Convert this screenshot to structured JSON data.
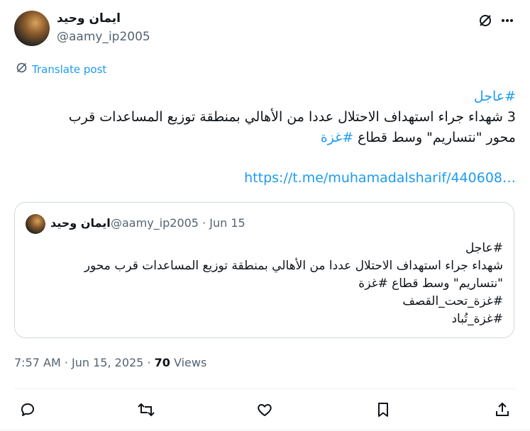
{
  "author": {
    "name": "ايمان وحيد",
    "handle": "@aamy_ip2005"
  },
  "translate_label": "Translate post",
  "tweet": {
    "line1": "#عاجل",
    "line2": "3 شهداء جراء استهداف الاحتلال عددا من الأهالي بمنطقة توزيع المساعدات قرب",
    "line3_text": "محور \"نتساريم\" وسط قطاع ",
    "line3_hashtag": "#غزة",
    "link": "https://t.me/muhamadalsharif/440608…"
  },
  "quote": {
    "name": "ايمان وحيد",
    "meta": "@aamy_ip2005 · Jun 15",
    "lines": [
      "#عاجل",
      "شهداء جراء استهداف الاحتلال عددا من الأهالي بمنطقة توزيع المساعدات قرب محور",
      "\"نتساريم\" وسط قطاع #غزة",
      "#غزة_تحت_القصف",
      "#غزة_تُباد"
    ]
  },
  "meta": {
    "time": "7:57 AM · Jun 15, 2025 · ",
    "views_count": "70",
    "views_label": " Views"
  },
  "colors": {
    "accent": "#1d9bf0",
    "muted": "#536471",
    "border": "#cfd9de"
  },
  "icons": [
    "grok-icon",
    "more-icon",
    "translate-icon",
    "reply-icon",
    "retweet-icon",
    "like-icon",
    "bookmark-icon",
    "share-icon"
  ]
}
